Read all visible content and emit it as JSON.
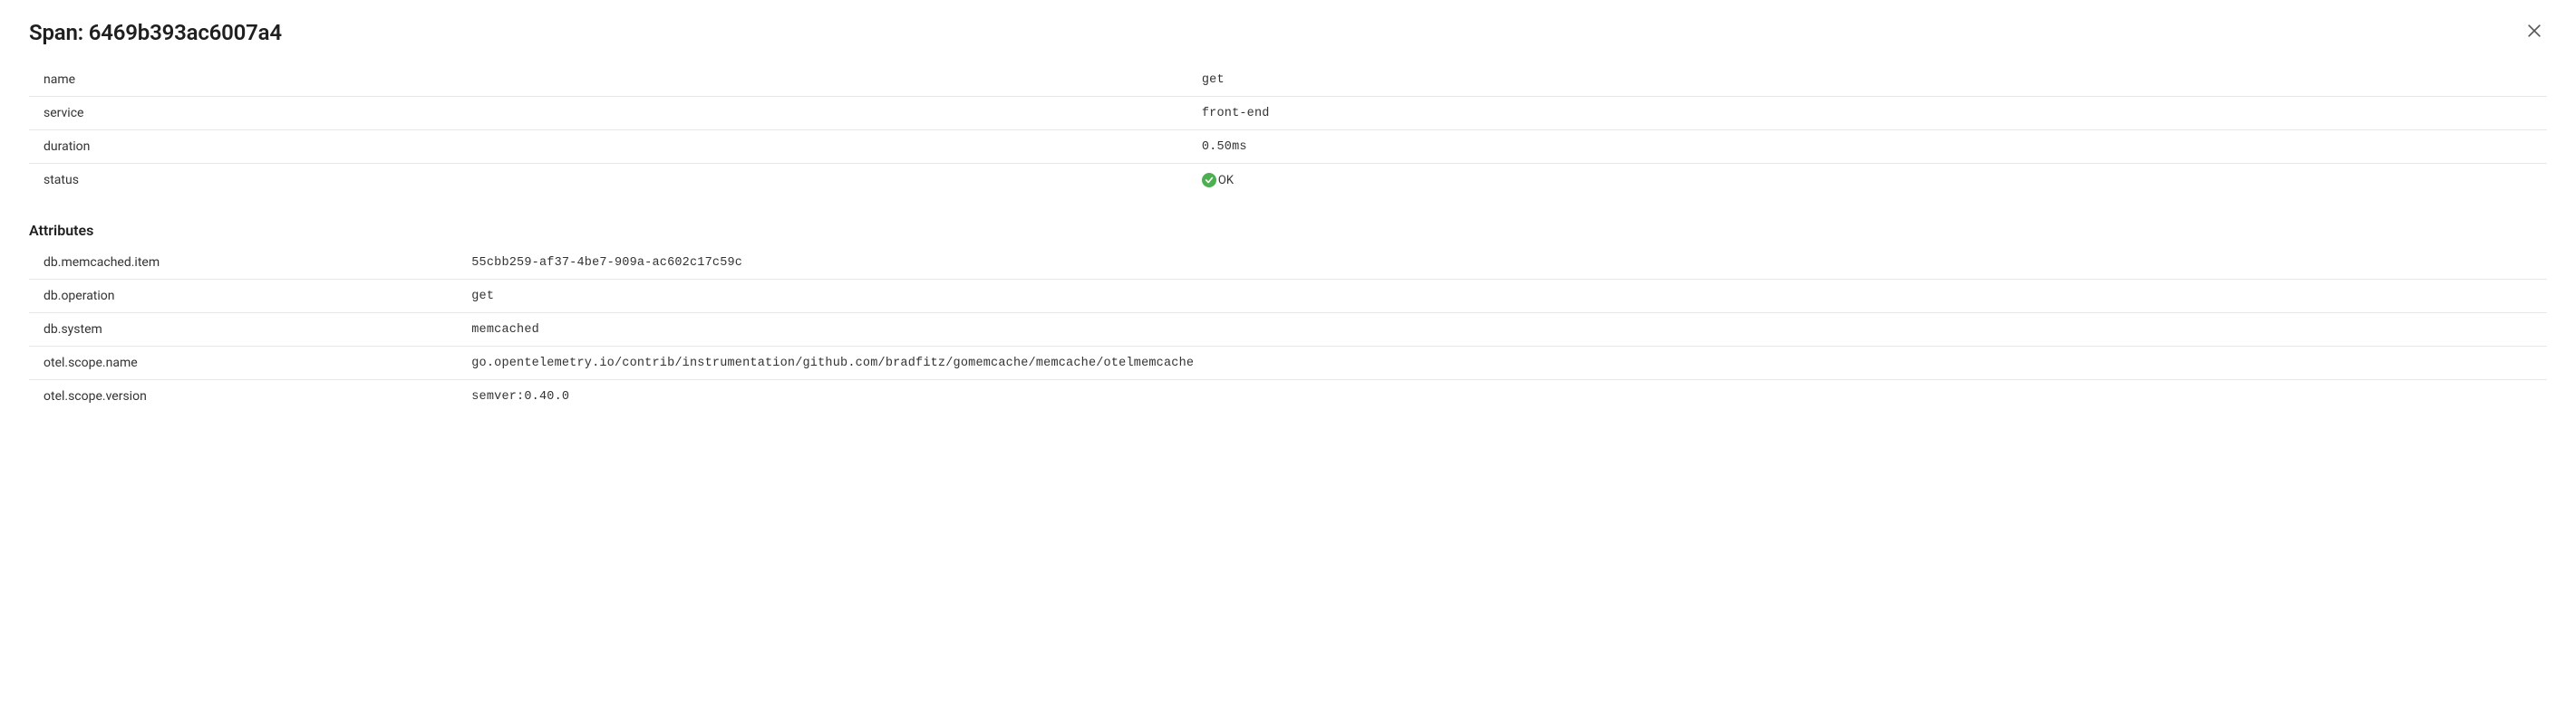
{
  "header": {
    "title_prefix": "Span: ",
    "span_id": "6469b393ac6007a4"
  },
  "summary": [
    {
      "key": "name",
      "value": "get"
    },
    {
      "key": "service",
      "value": "front-end"
    },
    {
      "key": "duration",
      "value": "0.50ms"
    },
    {
      "key": "status",
      "value": "OK",
      "status_ok": true
    }
  ],
  "sections": {
    "attributes_title": "Attributes"
  },
  "attributes": [
    {
      "key": "db.memcached.item",
      "value": "55cbb259-af37-4be7-909a-ac602c17c59c"
    },
    {
      "key": "db.operation",
      "value": "get"
    },
    {
      "key": "db.system",
      "value": "memcached"
    },
    {
      "key": "otel.scope.name",
      "value": "go.opentelemetry.io/contrib/instrumentation/github.com/bradfitz/gomemcache/memcache/otelmemcache"
    },
    {
      "key": "otel.scope.version",
      "value": "semver:0.40.0"
    }
  ]
}
